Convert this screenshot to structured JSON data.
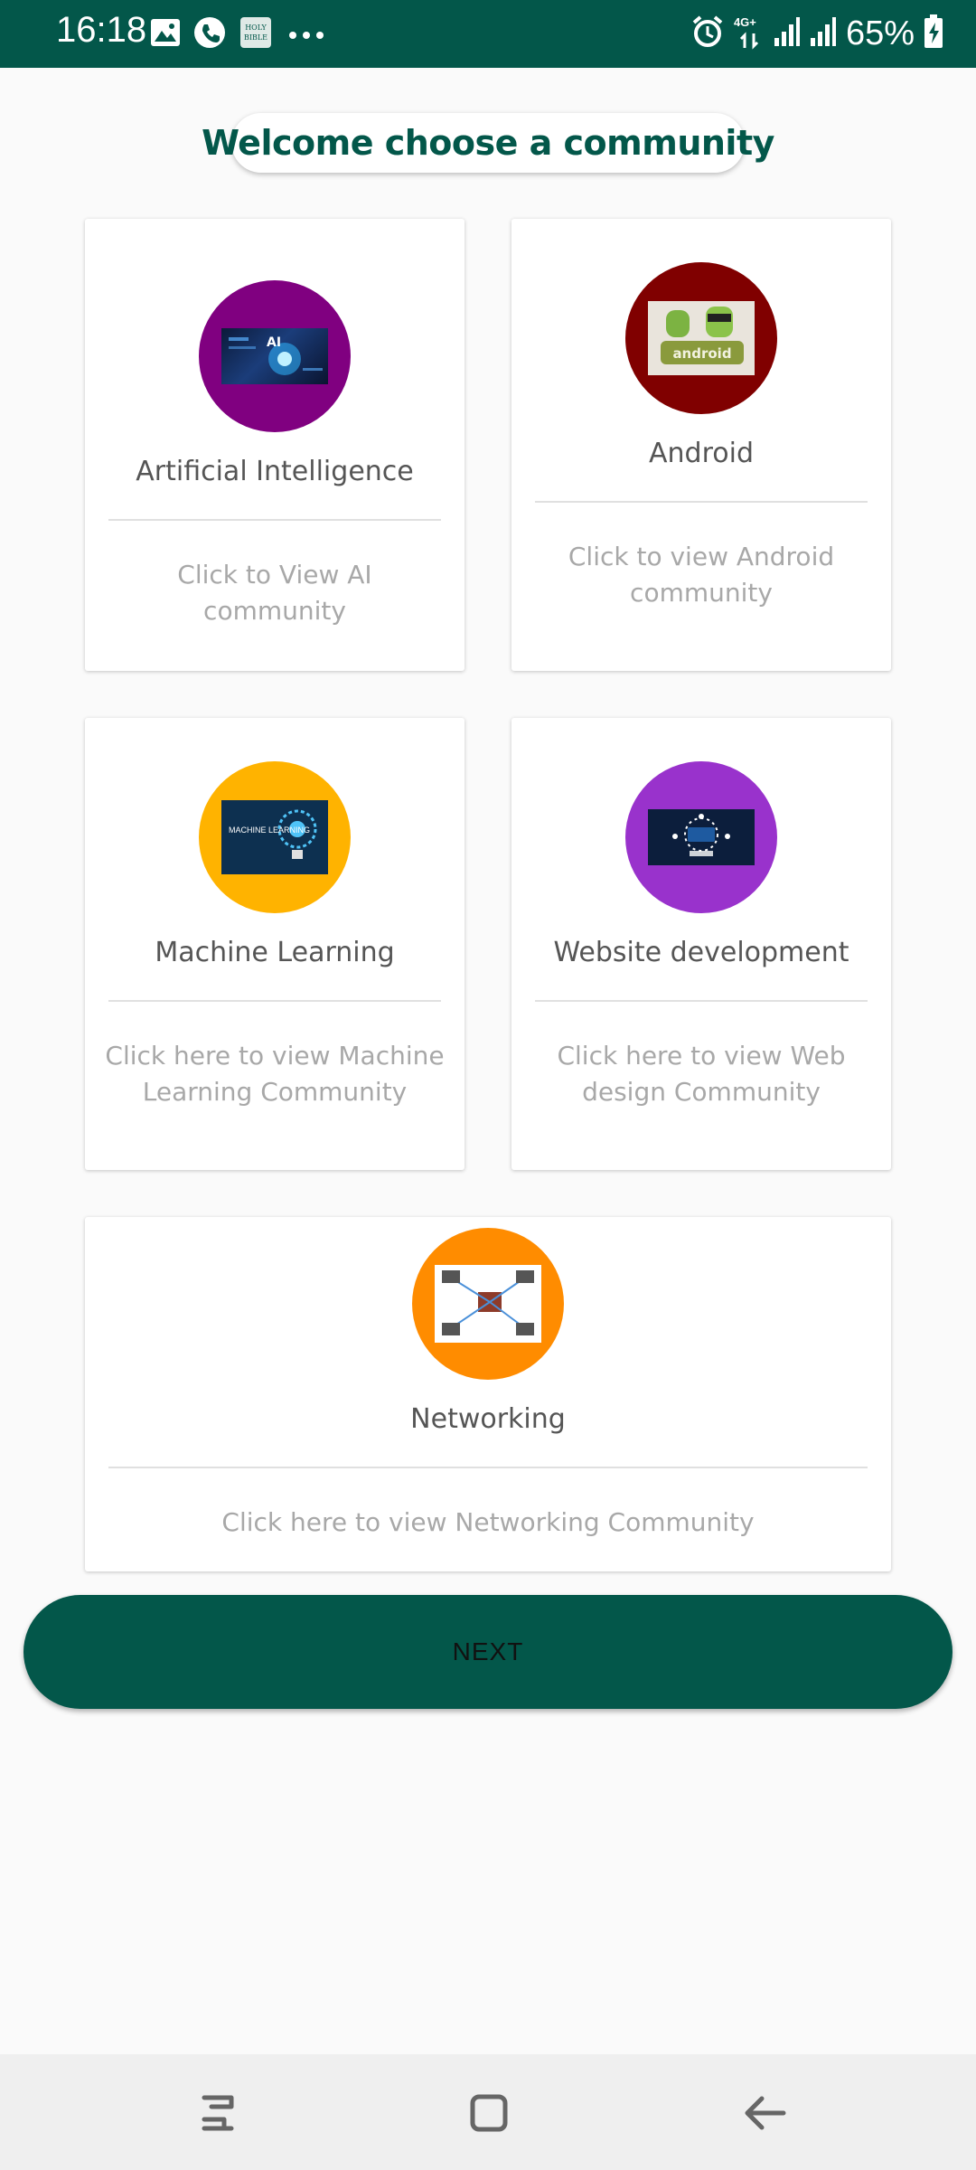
{
  "status_bar": {
    "time": "16:18",
    "battery": "65%",
    "network": "4G+",
    "background_color": "#03574a",
    "left_icons": [
      "gallery-icon",
      "phone-icon",
      "bible-app-icon",
      "more-dots-icon"
    ],
    "right_icons": [
      "alarm-icon",
      "data-arrows-icon",
      "signal-icon",
      "signal-icon",
      "battery-charging-icon"
    ]
  },
  "header": {
    "title": "Welcome choose a community"
  },
  "communities": [
    {
      "title": "Artificial Intelligence",
      "description": "Click to View AI community",
      "avatar_color": "#800080",
      "image_icon": "ai-image-icon"
    },
    {
      "title": "Android",
      "description": "Click to view Android community",
      "avatar_color": "#800000",
      "image_icon": "android-image-icon"
    },
    {
      "title": "Machine Learning",
      "description": "Click here to view Machine Learning Community",
      "avatar_color": "#ffb300",
      "image_icon": "machine-learning-image-icon",
      "image_text": "MACHINE LEARNING"
    },
    {
      "title": "Website development",
      "description": "Click here to view Web design Community",
      "avatar_color": "#9932cc",
      "image_icon": "web-development-image-icon"
    },
    {
      "title": "Networking",
      "description": "Click here to view Networking Community",
      "avatar_color": "#ff8c00",
      "image_icon": "networking-image-icon"
    }
  ],
  "next_button": {
    "label": "NEXT",
    "color": "#03574a"
  },
  "nav_bar": {
    "buttons": [
      "recent-apps-icon",
      "home-icon",
      "back-icon"
    ]
  }
}
